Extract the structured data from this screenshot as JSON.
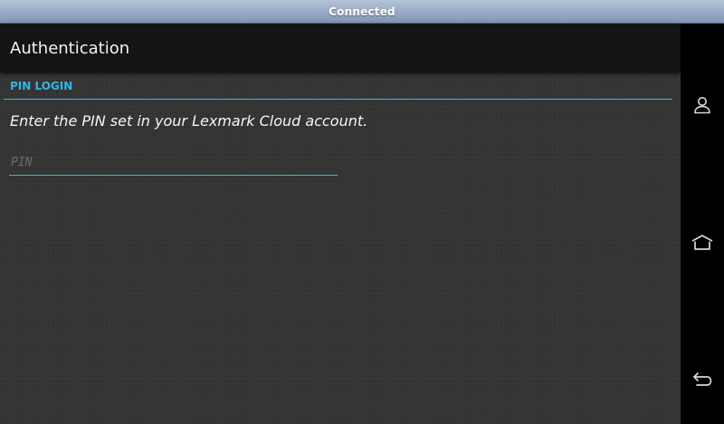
{
  "status_bar": {
    "text": "Connected"
  },
  "action_bar": {
    "title": "Authentication"
  },
  "section": {
    "label": "PIN LOGIN"
  },
  "form": {
    "instruction": "Enter the PIN set in your Lexmark Cloud account.",
    "pin_value": "",
    "pin_placeholder": "PIN"
  },
  "nav": {
    "icons": [
      "person-icon",
      "home-icon",
      "back-icon"
    ]
  },
  "colors": {
    "accent": "#33b5e5",
    "status_bar": "#94a7c4",
    "action_bar": "#141414",
    "background": "#333333"
  }
}
